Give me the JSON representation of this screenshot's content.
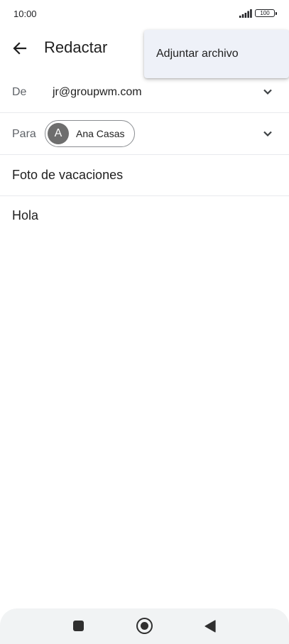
{
  "status_bar": {
    "time": "10:00",
    "battery": "100"
  },
  "app_bar": {
    "title": "Redactar"
  },
  "popup_menu": {
    "items": [
      {
        "label": "Adjuntar archivo"
      }
    ]
  },
  "compose": {
    "from_label": "De",
    "from_value": "jr@groupwm.com",
    "to_label": "Para",
    "recipients": [
      {
        "initial": "A",
        "name": "Ana Casas"
      }
    ],
    "subject": "Foto de vacaciones",
    "body": "Hola"
  },
  "icons": {
    "back": "arrow-back-icon",
    "expand": "chevron-down-icon",
    "signal": "signal-icon",
    "battery": "battery-icon",
    "nav_recents": "square-icon",
    "nav_home": "circle-icon",
    "nav_back": "triangle-back-icon"
  },
  "colors": {
    "menu_background": "#eef1f8",
    "divider": "#e8eaed",
    "chip_avatar": "#6e6e6e",
    "nav_bar": "#f1f3f4"
  }
}
